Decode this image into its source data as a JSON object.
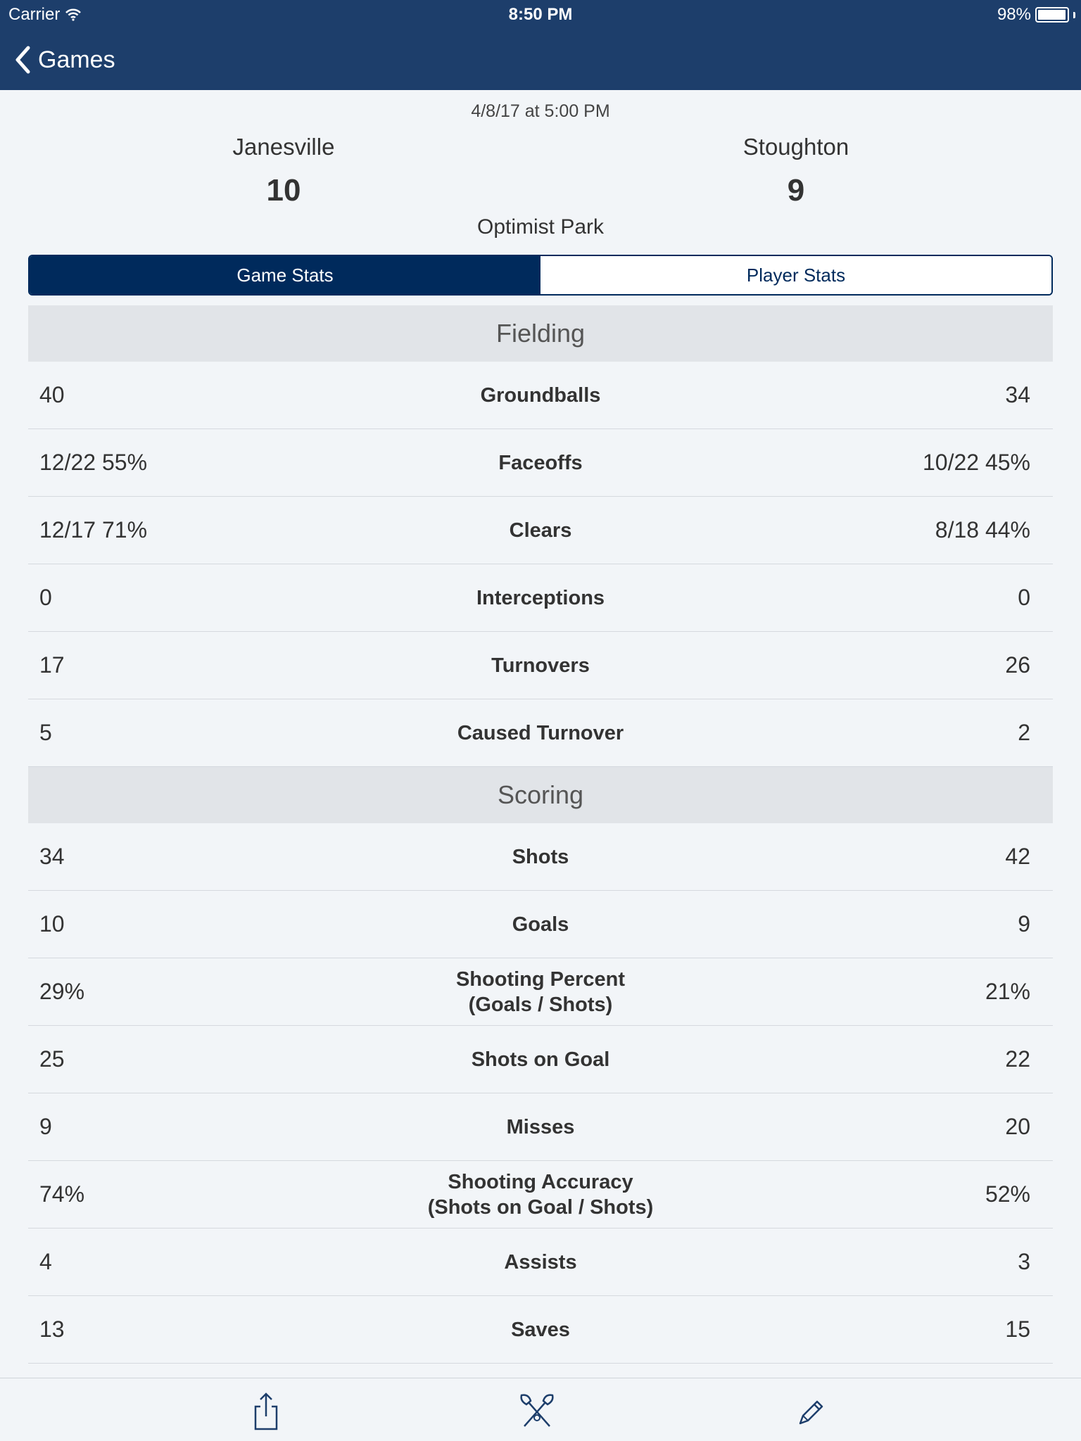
{
  "status_bar": {
    "carrier": "Carrier",
    "time": "8:50 PM",
    "battery": "98%",
    "battery_level": 0.98
  },
  "nav": {
    "back_label": "Games"
  },
  "game": {
    "datetime": "4/8/17 at 5:00 PM",
    "home": {
      "name": "Janesville",
      "score": "10"
    },
    "away": {
      "name": "Stoughton",
      "score": "9"
    },
    "venue": "Optimist Park"
  },
  "tabs": {
    "game_stats": "Game Stats",
    "player_stats": "Player Stats",
    "active": "game_stats"
  },
  "sections": [
    {
      "title": "Fielding",
      "rows": [
        {
          "label": "Groundballs",
          "home": "40",
          "away": "34"
        },
        {
          "label": "Faceoffs",
          "home": "12/22 55%",
          "away": "10/22 45%"
        },
        {
          "label": "Clears",
          "home": "12/17 71%",
          "away": "8/18 44%"
        },
        {
          "label": "Interceptions",
          "home": "0",
          "away": "0"
        },
        {
          "label": "Turnovers",
          "home": "17",
          "away": "26"
        },
        {
          "label": "Caused Turnover",
          "home": "5",
          "away": "2"
        }
      ]
    },
    {
      "title": "Scoring",
      "rows": [
        {
          "label": "Shots",
          "home": "34",
          "away": "42"
        },
        {
          "label": "Goals",
          "home": "10",
          "away": "9"
        },
        {
          "label": "Shooting Percent",
          "sublabel": "(Goals / Shots)",
          "home": "29%",
          "away": "21%"
        },
        {
          "label": "Shots on Goal",
          "home": "25",
          "away": "22"
        },
        {
          "label": "Misses",
          "home": "9",
          "away": "20"
        },
        {
          "label": "Shooting Accuracy",
          "sublabel": "(Shots on Goal / Shots)",
          "home": "74%",
          "away": "52%"
        },
        {
          "label": "Assists",
          "home": "4",
          "away": "3"
        },
        {
          "label": "Saves",
          "home": "13",
          "away": "15"
        }
      ]
    }
  ],
  "tabbar": {
    "icons": [
      "share-icon",
      "lacrosse-sticks-icon",
      "pencil-icon"
    ]
  },
  "colors": {
    "nav_bg": "#1d3e6b",
    "segment_active": "#002a5c",
    "section_bg": "#e1e4e8",
    "page_bg": "#f2f5f8"
  }
}
